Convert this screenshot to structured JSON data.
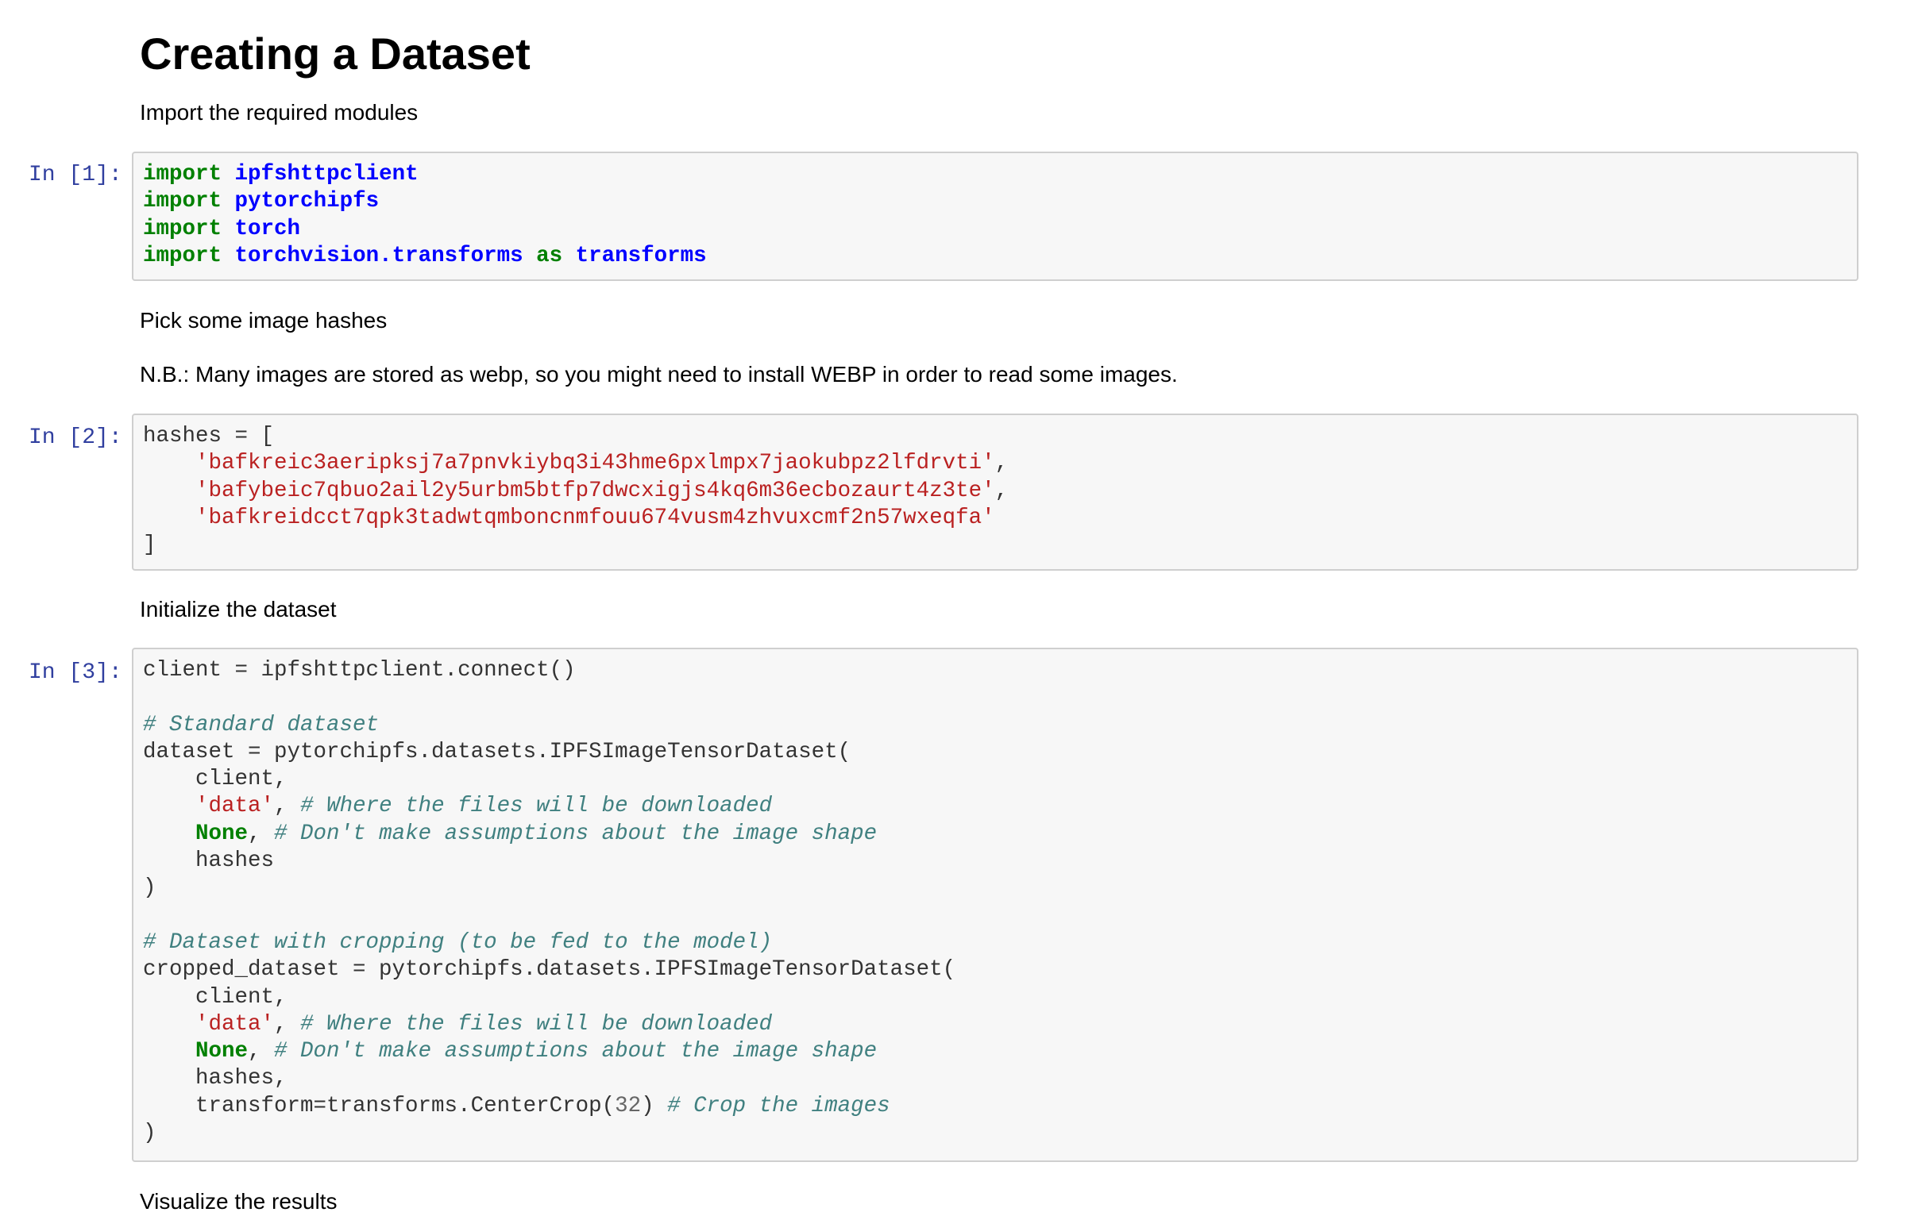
{
  "heading": "Creating a Dataset",
  "text1": "Import the required modules",
  "cell1": {
    "prompt": "In [1]:",
    "lines": [
      [
        {
          "c": "kw",
          "t": "import"
        },
        {
          "c": "",
          "t": " "
        },
        {
          "c": "mod",
          "t": "ipfshttpclient"
        }
      ],
      [
        {
          "c": "kw",
          "t": "import"
        },
        {
          "c": "",
          "t": " "
        },
        {
          "c": "mod",
          "t": "pytorchipfs"
        }
      ],
      [
        {
          "c": "kw",
          "t": "import"
        },
        {
          "c": "",
          "t": " "
        },
        {
          "c": "mod",
          "t": "torch"
        }
      ],
      [
        {
          "c": "kw",
          "t": "import"
        },
        {
          "c": "",
          "t": " "
        },
        {
          "c": "mod",
          "t": "torchvision.transforms"
        },
        {
          "c": "",
          "t": " "
        },
        {
          "c": "kw",
          "t": "as"
        },
        {
          "c": "",
          "t": " "
        },
        {
          "c": "mod",
          "t": "transforms"
        }
      ]
    ]
  },
  "text2": "Pick some image hashes",
  "text3": "N.B.: Many images are stored as webp, so you might need to install WEBP in order to read some images.",
  "cell2": {
    "prompt": "In [2]:",
    "lines": [
      [
        {
          "c": "",
          "t": "hashes = ["
        }
      ],
      [
        {
          "c": "",
          "t": "    "
        },
        {
          "c": "str",
          "t": "'bafkreic3aeripksj7a7pnvkiybq3i43hme6pxlmpx7jaokubpz2lfdrvti'"
        },
        {
          "c": "",
          "t": ","
        }
      ],
      [
        {
          "c": "",
          "t": "    "
        },
        {
          "c": "str",
          "t": "'bafybeic7qbuo2ail2y5urbm5btfp7dwcxigjs4kq6m36ecbozaurt4z3te'"
        },
        {
          "c": "",
          "t": ","
        }
      ],
      [
        {
          "c": "",
          "t": "    "
        },
        {
          "c": "str",
          "t": "'bafkreidcct7qpk3tadwtqmboncnmfouu674vusm4zhvuxcmf2n57wxeqfa'"
        }
      ],
      [
        {
          "c": "",
          "t": "]"
        }
      ]
    ]
  },
  "text4": "Initialize the dataset",
  "cell3": {
    "prompt": "In [3]:",
    "lines": [
      [
        {
          "c": "",
          "t": "client = ipfshttpclient.connect()"
        }
      ],
      [],
      [
        {
          "c": "com",
          "t": "# Standard dataset"
        }
      ],
      [
        {
          "c": "",
          "t": "dataset = pytorchipfs.datasets.IPFSImageTensorDataset("
        }
      ],
      [
        {
          "c": "",
          "t": "    client,"
        }
      ],
      [
        {
          "c": "",
          "t": "    "
        },
        {
          "c": "str",
          "t": "'data'"
        },
        {
          "c": "",
          "t": ", "
        },
        {
          "c": "com",
          "t": "# Where the files will be downloaded"
        }
      ],
      [
        {
          "c": "",
          "t": "    "
        },
        {
          "c": "kw",
          "t": "None"
        },
        {
          "c": "",
          "t": ", "
        },
        {
          "c": "com",
          "t": "# Don't make assumptions about the image shape"
        }
      ],
      [
        {
          "c": "",
          "t": "    hashes"
        }
      ],
      [
        {
          "c": "",
          "t": ")"
        }
      ],
      [],
      [
        {
          "c": "com",
          "t": "# Dataset with cropping (to be fed to the model)"
        }
      ],
      [
        {
          "c": "",
          "t": "cropped_dataset = pytorchipfs.datasets.IPFSImageTensorDataset("
        }
      ],
      [
        {
          "c": "",
          "t": "    client,"
        }
      ],
      [
        {
          "c": "",
          "t": "    "
        },
        {
          "c": "str",
          "t": "'data'"
        },
        {
          "c": "",
          "t": ", "
        },
        {
          "c": "com",
          "t": "# Where the files will be downloaded"
        }
      ],
      [
        {
          "c": "",
          "t": "    "
        },
        {
          "c": "kw",
          "t": "None"
        },
        {
          "c": "",
          "t": ", "
        },
        {
          "c": "com",
          "t": "# Don't make assumptions about the image shape"
        }
      ],
      [
        {
          "c": "",
          "t": "    hashes,"
        }
      ],
      [
        {
          "c": "",
          "t": "    transform=transforms.CenterCrop("
        },
        {
          "c": "num",
          "t": "32"
        },
        {
          "c": "",
          "t": ") "
        },
        {
          "c": "com",
          "t": "# Crop the images"
        }
      ],
      [
        {
          "c": "",
          "t": ")"
        }
      ]
    ]
  },
  "text5": "Visualize the results"
}
